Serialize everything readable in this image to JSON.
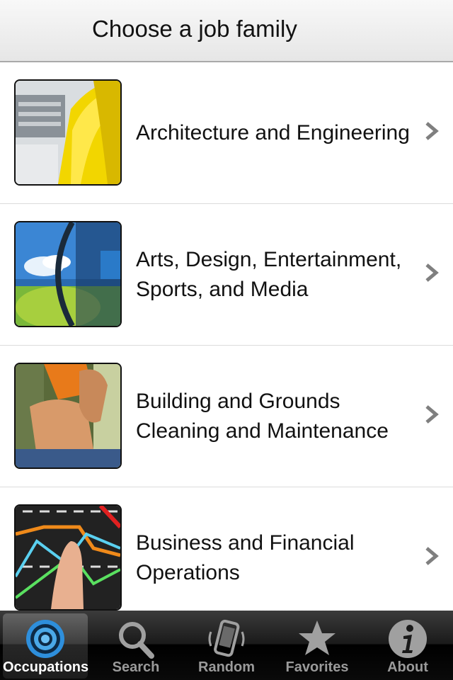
{
  "header": {
    "title": "Choose a job family"
  },
  "job_families": [
    {
      "label": "Architecture and Engineering",
      "thumbnail_icon": "hard-hat-thumbnail"
    },
    {
      "label": "Arts, Design, Entertainment, Sports, and Media",
      "thumbnail_icon": "lens-landscape-thumbnail"
    },
    {
      "label": "Building and Grounds Cleaning and Maintenance",
      "thumbnail_icon": "hands-tool-thumbnail"
    },
    {
      "label": "Business and Financial Operations",
      "thumbnail_icon": "touch-chart-thumbnail"
    }
  ],
  "tabbar": {
    "tabs": [
      {
        "label": "Occupations",
        "icon": "target-icon",
        "active": true
      },
      {
        "label": "Search",
        "icon": "magnifier-icon",
        "active": false
      },
      {
        "label": "Random",
        "icon": "shaking-phone-icon",
        "active": false
      },
      {
        "label": "Favorites",
        "icon": "star-icon",
        "active": false
      },
      {
        "label": "About",
        "icon": "info-icon",
        "active": false
      }
    ]
  },
  "colors": {
    "active_tab_icon": "#4aa8e8",
    "inactive_tab": "#9a9a9a",
    "chevron": "#7f7f7f"
  }
}
